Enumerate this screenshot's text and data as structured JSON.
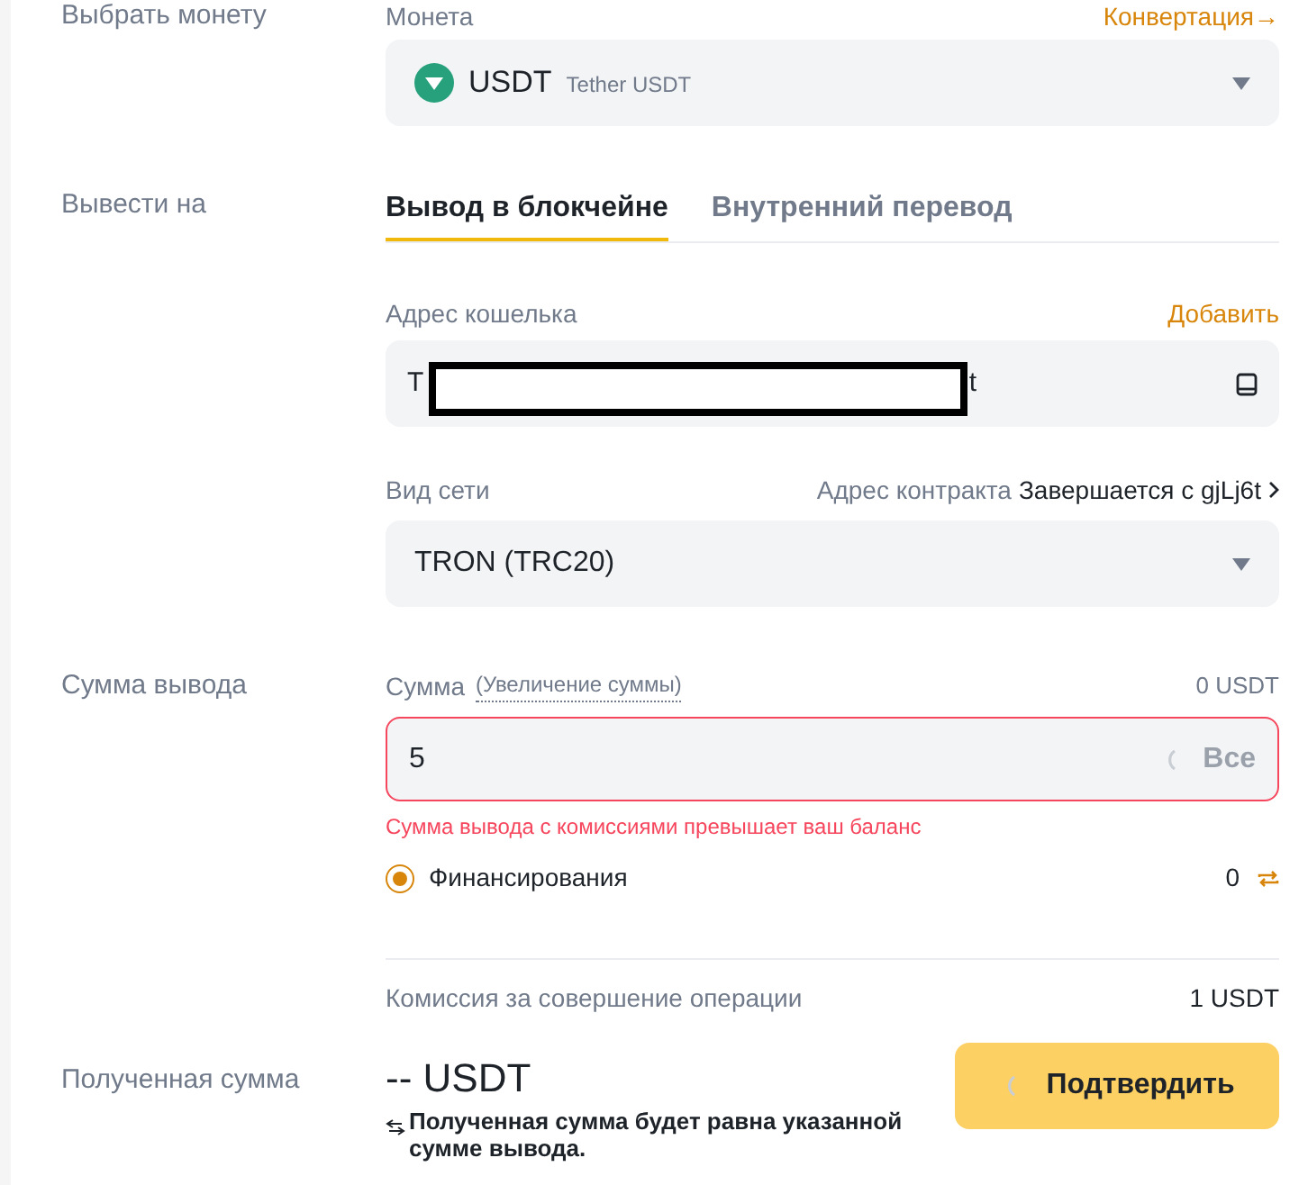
{
  "coin_section": {
    "label": "Выбрать монету",
    "field_label": "Монета",
    "convert_link": "Конвертация→",
    "coin": {
      "symbol": "USDT",
      "name": "Tether USDT"
    }
  },
  "withdraw_section": {
    "label": "Вывести на",
    "tabs": [
      {
        "label": "Вывод в блокчейне",
        "selected": true
      },
      {
        "label": "Внутренний перевод",
        "selected": false
      }
    ],
    "address": {
      "label": "Адрес кошелька",
      "add_link": "Добавить",
      "value_start": "T",
      "value_end": "t",
      "redacted": true
    },
    "network": {
      "label": "Вид сети",
      "contract_label": "Адрес контракта",
      "contract_value": "Завершается с gjLj6t",
      "value": "TRON (TRC20)"
    }
  },
  "amount_section": {
    "label": "Сумма вывода",
    "field_label": "Сумма",
    "increase_link": "(Увеличение суммы)",
    "balance": "0 USDT",
    "value": "5",
    "max_button": "Все",
    "loading": true,
    "error": "Сумма вывода с комиссиями превышает ваш баланс",
    "sources": [
      {
        "label": "Финансирования",
        "amount": "0",
        "selected": true
      }
    ],
    "fee_label": "Комиссия за совершение операции",
    "fee_value": "1 USDT"
  },
  "received_section": {
    "label": "Полученная сумма",
    "amount": "-- USDT",
    "note": "Полученная сумма будет равна указанной сумме вывода.",
    "confirm_button": "Подтвердить",
    "loading": true
  }
}
